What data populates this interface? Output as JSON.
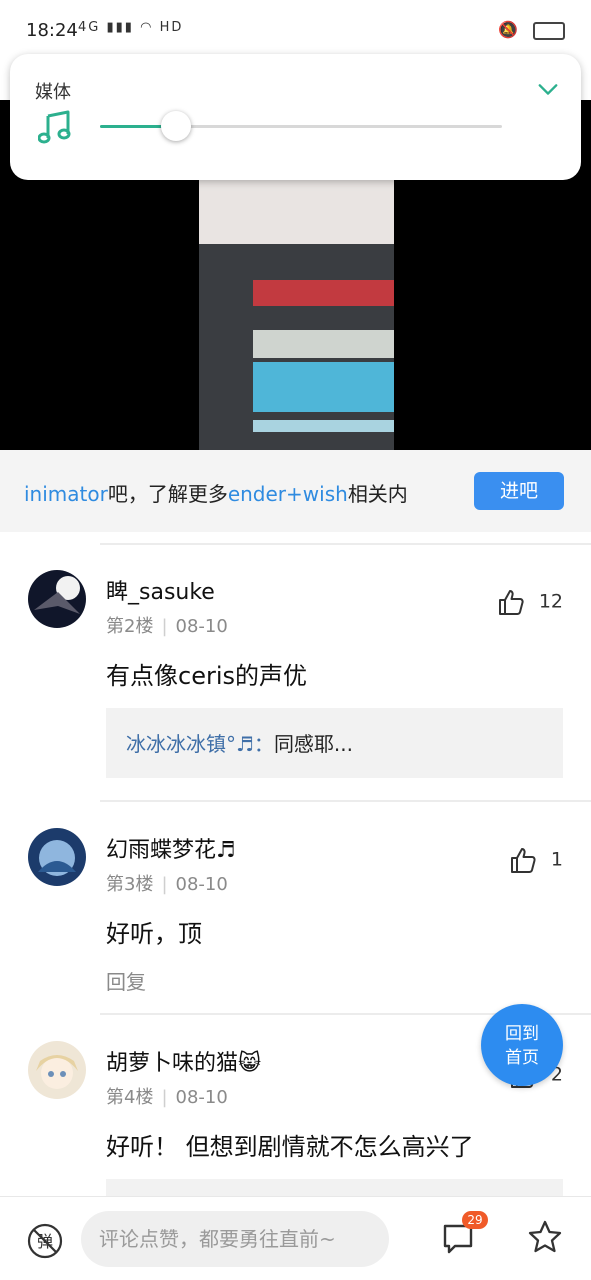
{
  "status_bar": {
    "time": "18:24",
    "signal_label": "4G",
    "hd_label": "HD"
  },
  "media_popup": {
    "label": "媒体",
    "volume_percent": 19,
    "accent": "#2cb08e"
  },
  "banner": {
    "text_part1": "inimator",
    "text_part2": "吧，了解更多",
    "text_part3": "ender+wish",
    "text_part4": "相关内",
    "button": "进吧"
  },
  "comments": [
    {
      "name": "睥_sasuke",
      "floor": "第2楼",
      "date": "08-10",
      "text": "有点像ceris的声优",
      "likes": "12",
      "reply": {
        "name": "冰冰冰冰镇°♬：",
        "body": "同感耶..."
      }
    },
    {
      "name": "幻雨蝶梦花♬",
      "floor": "第3楼",
      "date": "08-10",
      "text": "好听，顶",
      "likes": "1",
      "reply_link": "回复"
    },
    {
      "name": "胡萝卜味的猫😸",
      "floor": "第4楼",
      "date": "08-10",
      "text": "好听！ 但想到剧情就不怎么高兴了",
      "likes": "2"
    }
  ],
  "fab": {
    "line1": "回到",
    "line2": "首页"
  },
  "bottom_bar": {
    "input_placeholder": "评论点赞，都要勇往直前~",
    "comment_count": "29",
    "danmu_label": "弹"
  }
}
